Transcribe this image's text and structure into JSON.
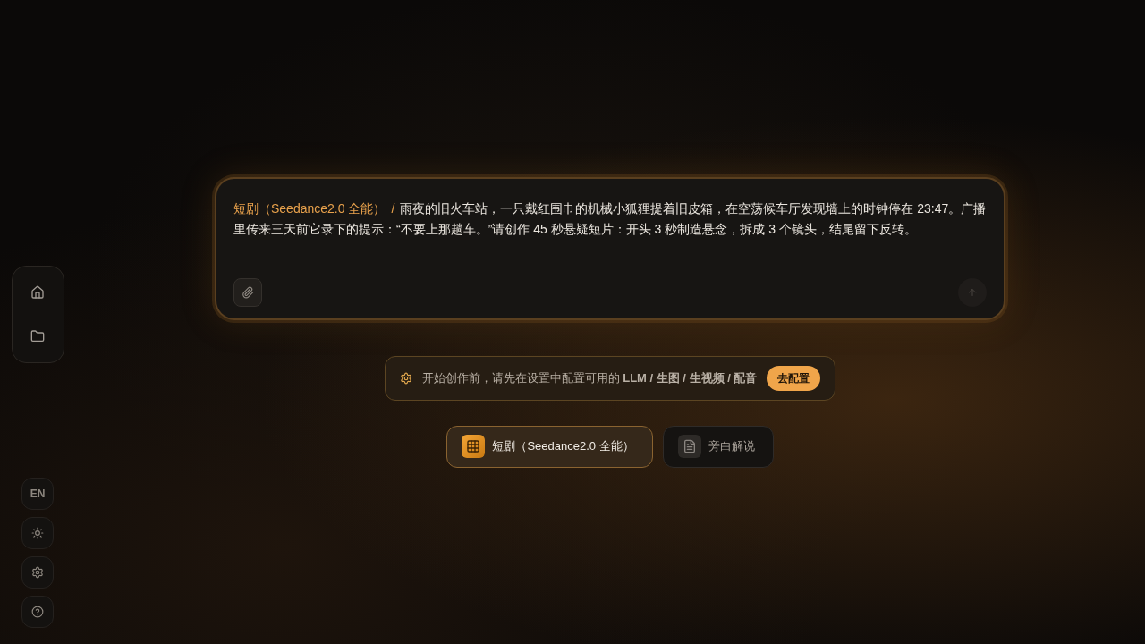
{
  "sidebar": {
    "language_button": {
      "label": "EN"
    }
  },
  "prompt_box": {
    "mode_tag": "短剧（Seedance2.0 全能）",
    "separator": "/",
    "value": "雨夜的旧火车站，一只戴红围巾的机械小狐狸提着旧皮箱，在空荡候车厅发现墙上的时钟停在 23:47。广播里传来三天前它录下的提示：“不要上那趟车。”请创作 45 秒悬疑短片：开头 3 秒制造悬念，拆成 3 个镜头，结尾留下反转。",
    "send_button": {
      "disabled": true
    }
  },
  "notice": {
    "text": "开始创作前，请先在设置中配置可用的 **LLM / 生图 / 生视频 / 配音**",
    "button": "去配置"
  },
  "modes": [
    {
      "label": "短剧（Seedance2.0 全能）",
      "kind": "drama",
      "selected": true
    },
    {
      "label": "旁白解说",
      "kind": "narration",
      "selected": false
    }
  ]
}
